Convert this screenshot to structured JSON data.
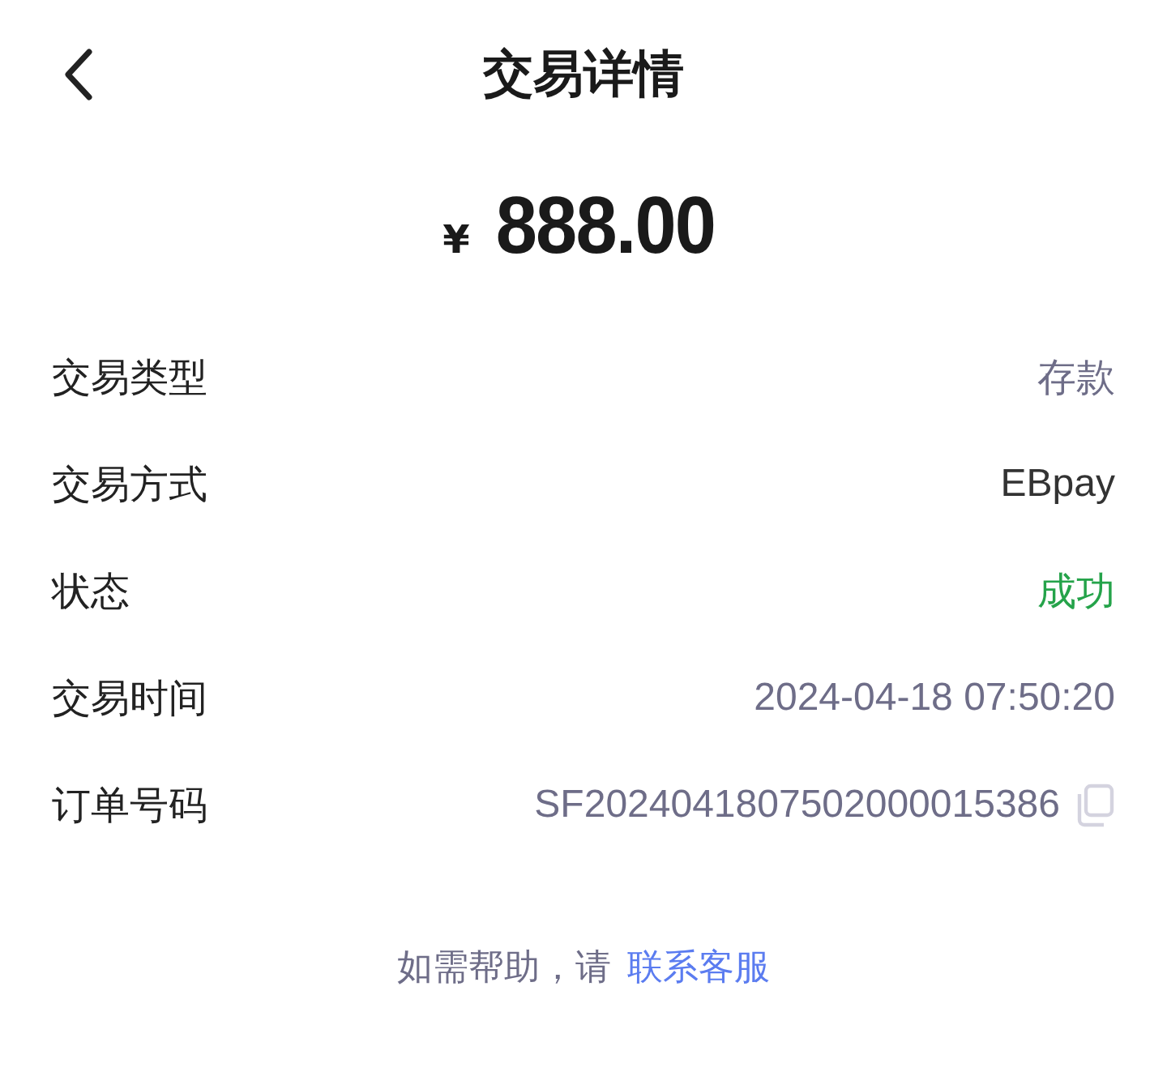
{
  "header": {
    "title": "交易详情"
  },
  "amount": {
    "currency": "¥",
    "value": "888.00"
  },
  "rows": [
    {
      "label": "交易类型",
      "value": "存款",
      "color": "#6e6d88",
      "copyable": false
    },
    {
      "label": "交易方式",
      "value": "EBpay",
      "color": "#333333",
      "copyable": false
    },
    {
      "label": "状态",
      "value": "成功",
      "color": "#25a34a",
      "copyable": false
    },
    {
      "label": "交易时间",
      "value": "2024-04-18 07:50:20",
      "color": "#6e6d88",
      "copyable": false
    },
    {
      "label": "订单号码",
      "value": "SF2024041807502000015386",
      "color": "#6e6d88",
      "copyable": true
    }
  ],
  "help": {
    "text": "如需帮助，请",
    "link": "联系客服"
  }
}
